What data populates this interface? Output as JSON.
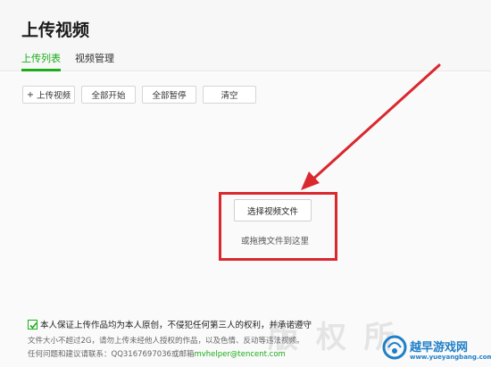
{
  "header": {
    "title": "上传视频",
    "tabs": [
      {
        "label": "上传列表",
        "active": true
      },
      {
        "label": "视频管理",
        "active": false
      }
    ]
  },
  "toolbar": {
    "add_label": "上传视频",
    "add_prefix": "+",
    "start_all_label": "全部开始",
    "pause_all_label": "全部暂停",
    "clear_label": "清空"
  },
  "upload_zone": {
    "select_label": "选择视频文件",
    "drag_hint": "或拖拽文件到这里"
  },
  "agreement": {
    "checked": true,
    "text": "本人保证上传作品均为本人原创，不侵犯任何第三人的权利，并承诺遵守",
    "note_line1": "文件大小不超过2G，请勿上传未经他人授权的作品，以及色情、反动等违法视频。",
    "note_line2_prefix": "任何问题和建议请联系：QQ3167697036或邮箱",
    "note_line2_email": "mvhelper@tencent.com"
  },
  "watermark": {
    "text": "越早游戏网",
    "url": "www.yueyangbang.com"
  },
  "colors": {
    "accent": "#1aad19",
    "highlight": "#d9282e",
    "arrow": "#d9282e",
    "watermark": "#1f7fc8"
  }
}
